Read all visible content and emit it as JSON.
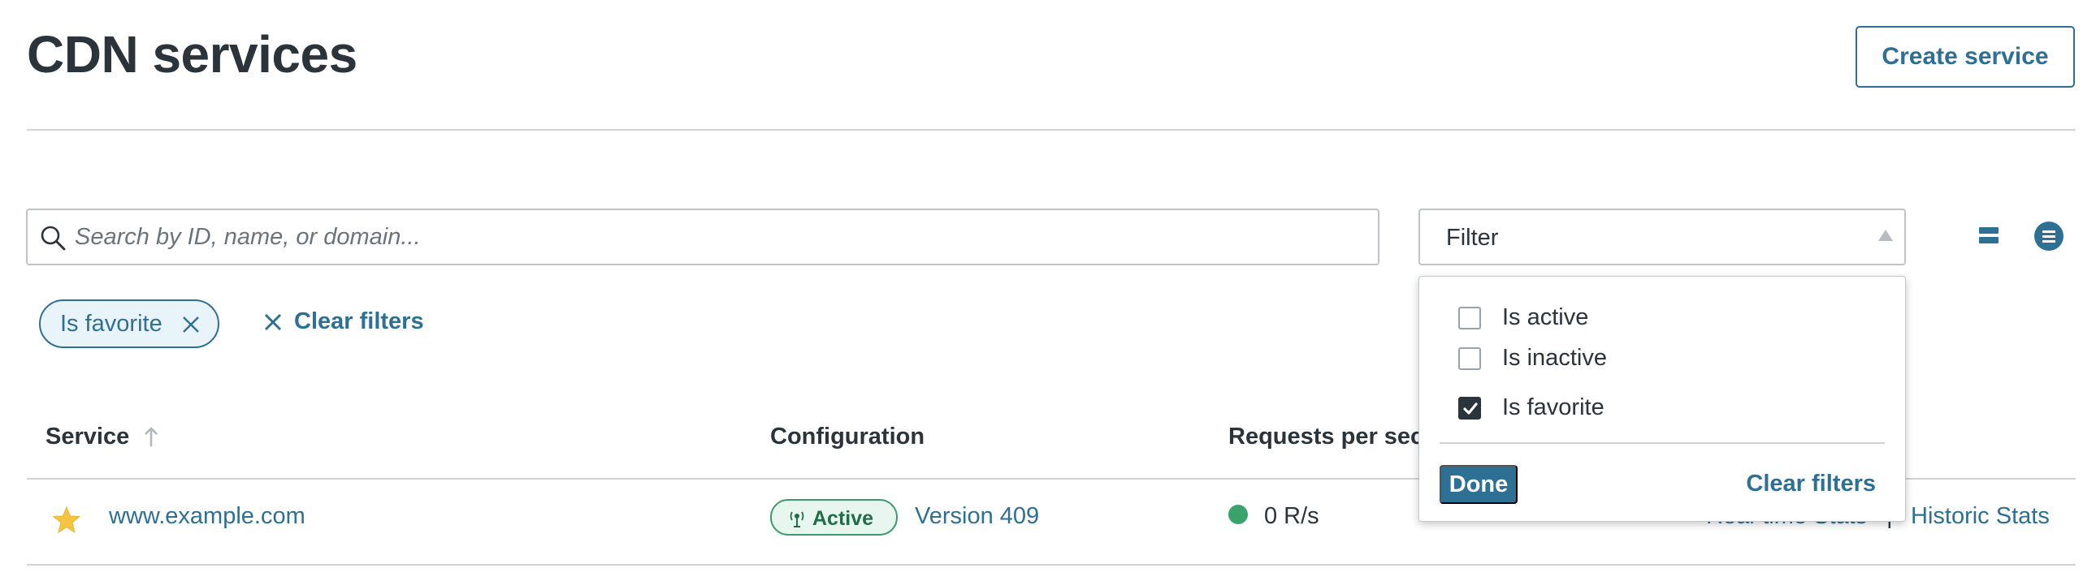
{
  "header": {
    "title": "CDN services",
    "create_button": "Create service"
  },
  "search": {
    "placeholder": "Search by ID, name, or domain...",
    "value": ""
  },
  "filter": {
    "label": "Filter",
    "options": [
      {
        "label": "Is active",
        "checked": false
      },
      {
        "label": "Is inactive",
        "checked": false
      },
      {
        "label": "Is favorite",
        "checked": true
      }
    ],
    "done_label": "Done",
    "clear_label": "Clear filters"
  },
  "active_filters": {
    "chips": [
      {
        "label": "Is favorite"
      }
    ],
    "clear_label": "Clear filters"
  },
  "table": {
    "columns": [
      "Service",
      "Configuration",
      "Requests per second"
    ],
    "rows": [
      {
        "service": "www.example.com",
        "favorite": true,
        "status": "Active",
        "version": "Version 409",
        "rps": "0 R/s",
        "realtime_link": "Real-time Stats",
        "separator": "|",
        "historic_link": "Historic Stats"
      }
    ]
  },
  "colors": {
    "accent": "#2e6f94",
    "text": "#2b333b",
    "active_green": "#3aa36c",
    "favorite_star": "#f5c542"
  },
  "icons": [
    "search-icon",
    "caret-up-icon",
    "compact-view-icon",
    "list-view-icon",
    "close-icon",
    "sort-arrow-up-icon",
    "star-icon",
    "active-status-icon",
    "check-icon"
  ]
}
